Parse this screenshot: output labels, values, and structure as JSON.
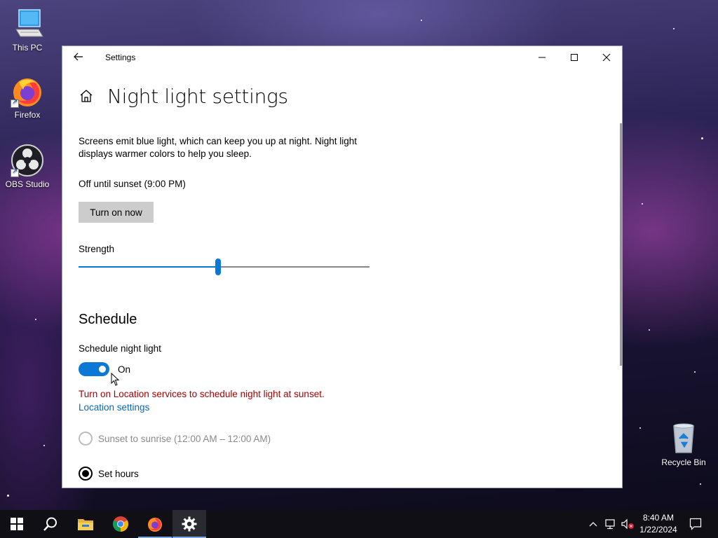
{
  "desktop": {
    "icons": [
      {
        "label": "This PC"
      },
      {
        "label": "Firefox"
      },
      {
        "label": "OBS Studio"
      },
      {
        "label": "Recycle Bin"
      }
    ]
  },
  "window": {
    "title": "Settings",
    "page_title": "Night light settings",
    "description": "Screens emit blue light, which can keep you up at night. Night light displays warmer colors to help you sleep.",
    "status": "Off until sunset (9:00 PM)",
    "turn_on_label": "Turn on now",
    "strength_label": "Strength",
    "strength_value": 48,
    "schedule_heading": "Schedule",
    "schedule_label": "Schedule night light",
    "schedule_toggle_state": "On",
    "warning": "Turn on Location services to schedule night light at sunset.",
    "location_link": "Location settings",
    "radio_options": [
      {
        "label": "Sunset to sunrise (12:00 AM – 12:00 AM)",
        "selected": false,
        "disabled": true
      },
      {
        "label": "Set hours",
        "selected": true,
        "disabled": false
      }
    ]
  },
  "taskbar": {
    "apps": [
      "start-icon",
      "search-icon",
      "file-explorer-icon",
      "chrome-icon",
      "firefox-icon",
      "settings-icon"
    ],
    "time": "8:40 AM",
    "date": "1/22/2024"
  },
  "colors": {
    "accent": "#0a78d4",
    "warning": "#a80000",
    "link": "#0b66b8"
  }
}
